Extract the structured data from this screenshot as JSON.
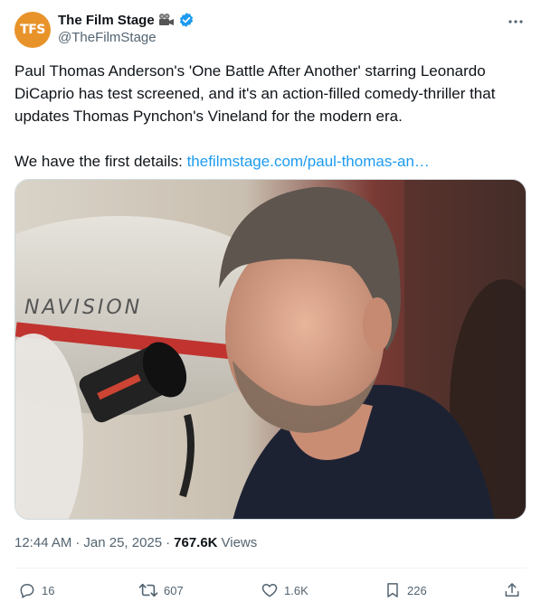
{
  "author": {
    "avatar_text": "TFS",
    "display_name": "The Film Stage",
    "handle": "@TheFilmStage"
  },
  "tweet": {
    "text_line1": "Paul Thomas Anderson's 'One Battle After Another' starring Leonardo DiCaprio has test screened, and it's an action-filled comedy-thriller that updates Thomas Pynchon's Vineland for the modern era.",
    "text_prefix": "We have the first details: ",
    "link_text": "thefilmstage.com/paul-thomas-an…"
  },
  "media": {
    "camera_label": "NAVISION"
  },
  "meta": {
    "time": "12:44 AM",
    "separator": "·",
    "date": "Jan 25, 2025",
    "separator2": "·",
    "views_count": "767.6K",
    "views_label": "Views"
  },
  "actions": {
    "replies": "16",
    "reposts": "607",
    "likes": "1.6K",
    "bookmarks": "226"
  },
  "colors": {
    "accent": "#1d9bf0",
    "avatar_bg": "#e8932a",
    "muted": "#536471"
  }
}
